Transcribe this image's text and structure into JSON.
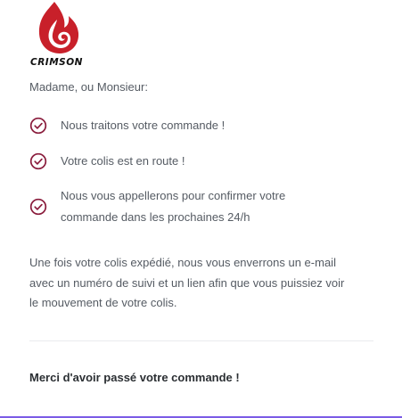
{
  "logo": {
    "brand_text": "CRIMSON",
    "icon": "flame-logo-icon"
  },
  "greeting": "Madame, ou Monsieur:",
  "steps": [
    {
      "icon": "check-circle-icon",
      "text": "Nous traitons votre commande !"
    },
    {
      "icon": "check-circle-icon",
      "text": "Votre colis est en route !"
    },
    {
      "icon": "check-circle-icon",
      "line1": "Nous vous appellerons pour confirmer votre",
      "line2": "commande dans les prochaines 24/h"
    }
  ],
  "paragraph": {
    "line1": "Une fois votre colis expédié, nous vous enverrons un e-mail",
    "line2": "avec un numéro de suivi et un lien afin que vous puissiez voir",
    "line3": "le mouvement de votre colis."
  },
  "thanks": "Merci d'avoir passé votre commande !",
  "colors": {
    "brand_red": "#c8202a",
    "check_color": "#8a1c3c",
    "text": "#555b63",
    "accent_bar": "#7b5ce6"
  }
}
